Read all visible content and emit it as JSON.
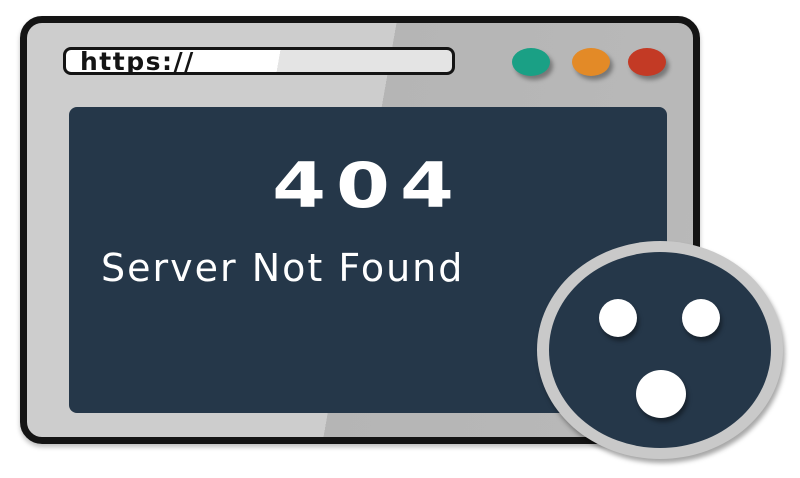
{
  "browser": {
    "address_bar": {
      "url_text": "https://"
    },
    "window_controls": [
      {
        "name": "green",
        "color": "#1aa085"
      },
      {
        "name": "orange",
        "color": "#e38a27"
      },
      {
        "name": "red",
        "color": "#c33a25"
      }
    ]
  },
  "content": {
    "error_code": "404",
    "error_message": "Server Not Found"
  },
  "face": {
    "icon": "surprised-face-icon",
    "color": "#253749"
  },
  "colors": {
    "frame_border": "#141414",
    "frame_fill": "#cdcdcd",
    "panel_background": "#253749",
    "text": "#ffffff"
  }
}
